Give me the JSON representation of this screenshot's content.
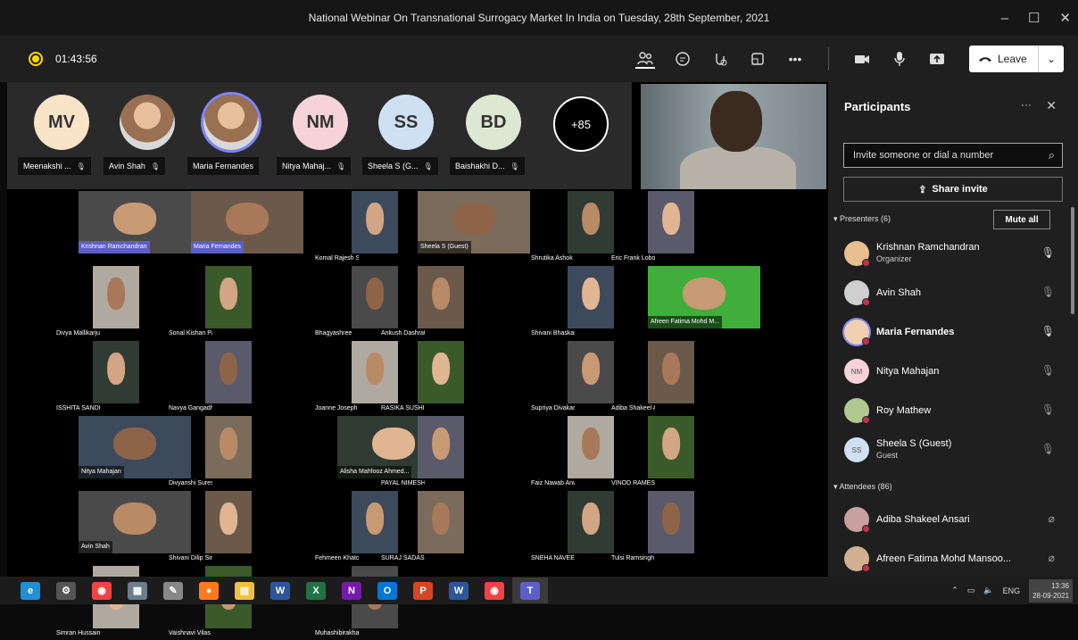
{
  "window": {
    "title": "National Webinar On Transnational Surrogacy Market In India on Tuesday, 28th September, 2021",
    "controls": [
      "–",
      "☐",
      "✕"
    ]
  },
  "call": {
    "timer": "01:43:56",
    "leave_label": "Leave",
    "icons": [
      "participants-icon",
      "chat-icon",
      "reactions-icon",
      "rooms-icon",
      "more-icon",
      "camera-icon",
      "mic-icon",
      "share-icon"
    ]
  },
  "strip": {
    "avatars": [
      {
        "initials": "MV",
        "label": "Meenakshi ...",
        "bg": "#f9e4c8"
      },
      {
        "initials": "",
        "label": "Avin Shah",
        "bg": "#ddd"
      },
      {
        "initials": "",
        "label": "Maria Fernandes",
        "bg": "#ddd"
      },
      {
        "initials": "NM",
        "label": "Nitya Mahaj...",
        "bg": "#f5d3d8"
      },
      {
        "initials": "SS",
        "label": "Sheela S (G...",
        "bg": "#cfe0f2"
      },
      {
        "initials": "BD",
        "label": "Baishakhi D...",
        "bg": "#dde8d4"
      }
    ],
    "overflow": "+85"
  },
  "gallery": {
    "tiles": [
      "Krishnan Ramchandran",
      "Maria Fernandes",
      "Komal Rajesh Singh",
      "Sheela S (Guest)",
      "Shrutika Ashok Shinde",
      "Eric Frank Lobo",
      "Divya Mallikarjun Sudd...",
      "Sonal Kishan Patil",
      "Bhagyashree",
      "Ankush Dashrath Dash...",
      "Shivani Bhaskar Samala",
      "Afreen Fatima Mohd M...",
      "ISSHITA SANDEEP JAD...",
      "Navya Gangadhar Gun...",
      "Joanne Joseph Rodrigues",
      "RASIKA SUSHILKUMA...",
      "Supriya Divakar Salian",
      "Adiba Shakeel Ansari",
      "Nitya Mahajan",
      "Divyanshi Suresh Bothra",
      "Alisha Mahfooz Ahmed...",
      "PAYAL NIMESH SHAH",
      "Faiz Nawab Anwar Baig",
      "VINOD RAMESH BAGU",
      "Avin Shah",
      "Shivani Dilip Singh",
      "Fehmeen Khatoon Imr...",
      "SURAJ SADASHIVA SH...",
      "SNEHA NAVEEN POOJ...",
      "Tulsi Ramsingh Choud...",
      "Simran Hussain Shaikh",
      "Vaishnavi Vilas Bandal",
      "Muhashibirakhan"
    ]
  },
  "panel": {
    "title": "Participants",
    "invite_placeholder": "Invite someone or dial a number",
    "share_invite": "Share invite",
    "presenters_label": "Presenters (6)",
    "mute_all": "Mute all",
    "attendees_label": "Attendees (86)",
    "presenters": [
      {
        "name": "Krishnan Ramchandran",
        "sub": "Organizer",
        "initials": "",
        "bold": false,
        "mic": "mic-icon"
      },
      {
        "name": "Avin Shah",
        "sub": "",
        "initials": "",
        "bold": false,
        "mic": "mic-off-icon"
      },
      {
        "name": "Maria Fernandes",
        "sub": "",
        "initials": "",
        "bold": true,
        "mic": "mic-icon"
      },
      {
        "name": "Nitya Mahajan",
        "sub": "",
        "initials": "NM",
        "bold": false,
        "mic": "mic-off-icon"
      },
      {
        "name": "Roy Mathew",
        "sub": "",
        "initials": "",
        "bold": false,
        "mic": "mic-off-icon"
      },
      {
        "name": "Sheela S (Guest)",
        "sub": "Guest",
        "initials": "SS",
        "bold": false,
        "mic": "mic-off-icon"
      }
    ],
    "attendees": [
      {
        "name": "Adiba Shakeel Ansari",
        "mic": "mic-disabled-icon"
      },
      {
        "name": "Afreen Fatima Mohd Mansoo...",
        "mic": "mic-disabled-icon"
      }
    ]
  },
  "taskbar": {
    "apps": [
      "edge",
      "settings",
      "chrome",
      "calculator",
      "paint",
      "firefox",
      "files",
      "word-doc",
      "excel",
      "onenote",
      "outlook",
      "powerpoint",
      "word",
      "chrome-2",
      "teams"
    ],
    "lang": "ENG",
    "time": "13:36",
    "date": "28-09-2021"
  },
  "colors": {
    "accent": "#5b5fc7",
    "mic_off": "#c4314b",
    "leave_bg": "#ffffff"
  }
}
